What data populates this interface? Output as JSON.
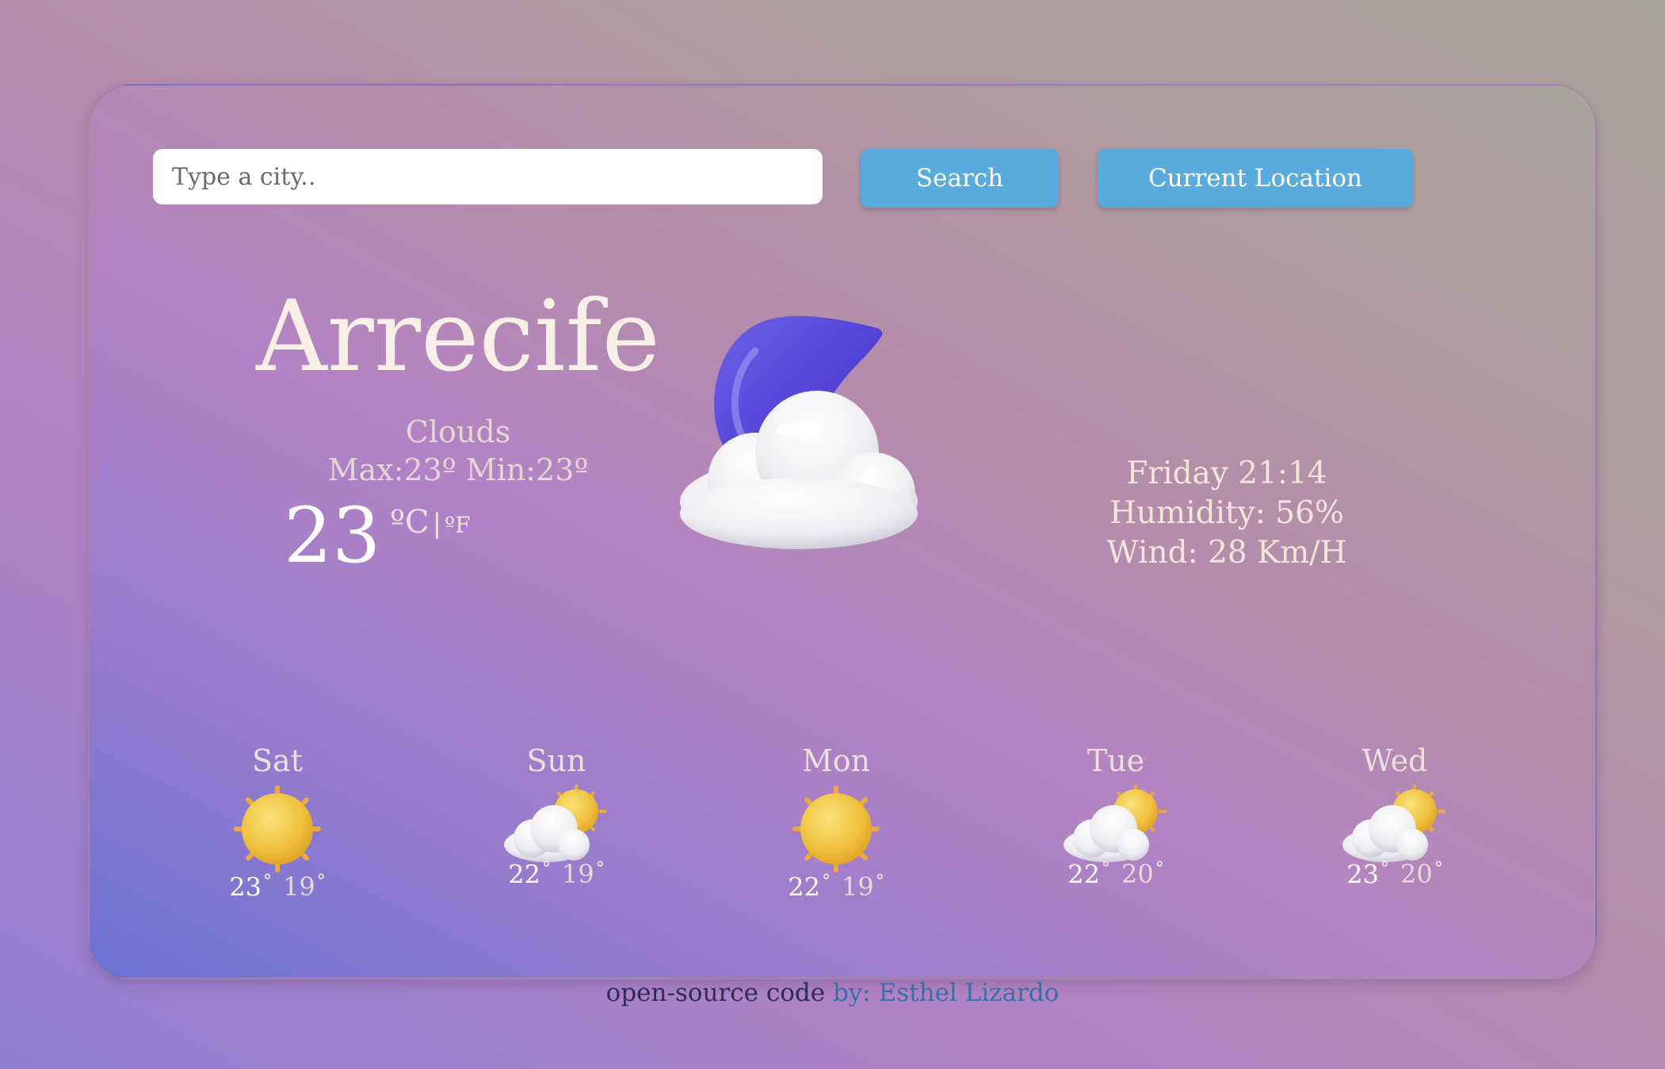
{
  "search": {
    "placeholder": "Type a city..",
    "value": "",
    "button_label": "Search",
    "location_button_label": "Current Location"
  },
  "current": {
    "city": "Arrecife",
    "description": "Clouds",
    "max_min": "Max:23º Min:23º",
    "temperature": "23",
    "unit_c": "ºC",
    "unit_separator": "|",
    "unit_f": "ºF",
    "icon": "moon-cloud-icon",
    "date_time": "Friday 21:14",
    "humidity": "Humidity: 56%",
    "wind": "Wind: 28 Km/H"
  },
  "forecast": [
    {
      "day": "Sat",
      "max": "23",
      "min": "19",
      "icon": "sun-icon"
    },
    {
      "day": "Sun",
      "max": "22",
      "min": "19",
      "icon": "sun-cloud-icon"
    },
    {
      "day": "Mon",
      "max": "22",
      "min": "19",
      "icon": "sun-icon"
    },
    {
      "day": "Tue",
      "max": "22",
      "min": "20",
      "icon": "sun-cloud-icon"
    },
    {
      "day": "Wed",
      "max": "23",
      "min": "20",
      "icon": "sun-cloud-icon"
    }
  ],
  "degree_symbol": "°",
  "footer": {
    "code_text": "open-source code",
    "author_text": "by: Esthel Lizardo"
  },
  "colors": {
    "button": "#5aabdd",
    "city_text": "#f8efe6",
    "footer_link": "#3570a8",
    "moon": "#5a4ad8",
    "sun": "#f0c13e"
  }
}
